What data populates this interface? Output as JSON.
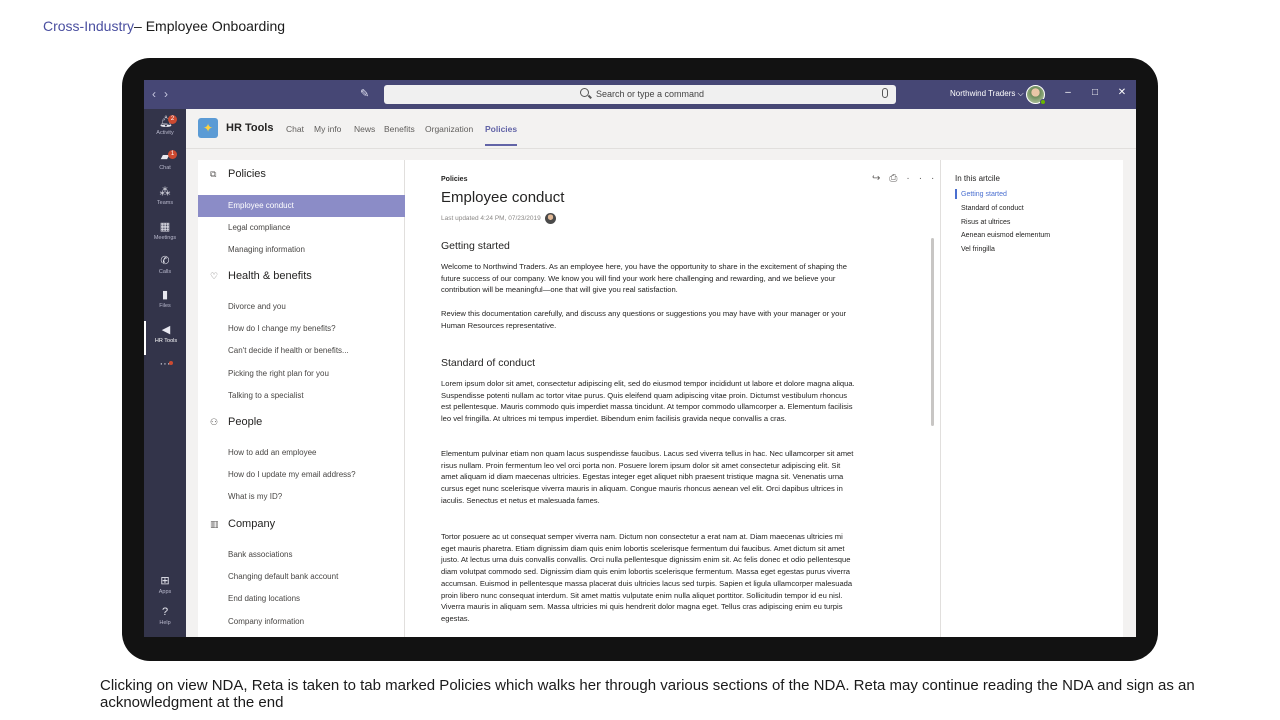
{
  "slide": {
    "category": "Cross-Industry",
    "title": "– Employee Onboarding",
    "caption": "Clicking on view NDA, Reta is taken to tab marked Policies which walks her through various sections of the NDA. Reta may continue reading the NDA and sign as an acknowledgment  at the end"
  },
  "titlebar": {
    "search_placeholder": "Search or type a command",
    "tenant": "Northwind Traders ⌵",
    "back_icon": "chevron-left-icon",
    "forward_icon": "chevron-right-icon"
  },
  "appbar": {
    "items": [
      {
        "label": "Activity",
        "icon": "bell-icon",
        "badge": "2"
      },
      {
        "label": "Chat",
        "icon": "chat-icon",
        "badge": "1"
      },
      {
        "label": "Teams",
        "icon": "teams-icon"
      },
      {
        "label": "Meetings",
        "icon": "calendar-icon"
      },
      {
        "label": "Calls",
        "icon": "phone-icon"
      },
      {
        "label": "Files",
        "icon": "files-icon"
      },
      {
        "label": "HR Tools",
        "icon": "megaphone-icon"
      },
      {
        "label": "",
        "icon": "more-icon"
      },
      {
        "label": "Apps",
        "icon": "apps-icon"
      },
      {
        "label": "Help",
        "icon": "help-icon"
      }
    ]
  },
  "tabheader": {
    "app_name": "HR Tools",
    "tabs": [
      "Chat",
      "My info",
      "News",
      "Benefits",
      "Organization",
      "Policies"
    ],
    "active_tab": "Policies"
  },
  "nav": {
    "sections": [
      {
        "label": "Policies",
        "icon": "documents-icon",
        "items": [
          "Employee conduct",
          "Legal compliance",
          "Managing information"
        ]
      },
      {
        "label": "Health & benefits",
        "icon": "heart-icon",
        "items": [
          "Divorce and you",
          "How do I change my benefits?",
          "Can't decide if health or benefits...",
          "Picking the right plan for you",
          "Talking to a specialist"
        ]
      },
      {
        "label": "People",
        "icon": "people-icon",
        "items": [
          "How to add an employee",
          "How do I update my email address?",
          "What is my ID?"
        ]
      },
      {
        "label": "Company",
        "icon": "building-icon",
        "items": [
          "Bank associations",
          "Changing default bank account",
          "End dating locations",
          "Company information"
        ]
      }
    ],
    "active_item": "Employee conduct"
  },
  "article": {
    "kicker": "Policies",
    "title": "Employee conduct",
    "meta": "Last updated 4:24 PM, 07/23/2019",
    "sections": [
      {
        "heading": "Getting started",
        "paragraphs": [
          "Welcome to Northwind Traders. As an employee here, you have the opportunity to share in the excitement of shaping the future success of our company. We know you will find your work here challenging and rewarding, and we believe your contribution will be meaningful—one that will give you real satisfaction.",
          "Review this documentation carefully, and discuss any questions or suggestions you may have with your manager or your Human Resources representative."
        ]
      },
      {
        "heading": "Standard of conduct",
        "paragraphs": [
          "Lorem ipsum dolor sit amet, consectetur adipiscing elit, sed do eiusmod tempor incididunt ut labore et dolore magna aliqua. Suspendisse potenti nullam ac tortor vitae purus. Quis eleifend quam adipiscing vitae proin. Dictumst vestibulum rhoncus est pellentesque. Mauris commodo quis imperdiet massa tincidunt. At tempor commodo ullamcorper a. Elementum facilisis leo vel fringilla. At ultrices mi tempus imperdiet. Bibendum enim facilisis gravida neque convallis a cras.",
          "Elementum pulvinar etiam non quam lacus suspendisse faucibus. Lacus sed viverra tellus in hac. Nec ullamcorper sit amet risus nullam. Proin fermentum leo vel orci porta non. Posuere lorem ipsum dolor sit amet consectetur adipiscing elit. Sit amet aliquam id diam maecenas ultricies. Egestas integer eget aliquet nibh praesent tristique magna sit. Venenatis urna cursus eget nunc scelerisque viverra mauris in aliquam. Congue mauris rhoncus aenean vel elit. Orci dapibus ultrices in iaculis. Senectus et netus et malesuada fames.",
          "Tortor posuere ac ut consequat semper viverra nam. Dictum non consectetur a erat nam at. Diam maecenas ultricies mi eget mauris pharetra. Etiam dignissim diam quis enim lobortis scelerisque fermentum dui faucibus. Amet dictum sit amet justo. At lectus urna duis convallis convallis. Orci nulla pellentesque dignissim enim sit. Ac felis donec et odio pellentesque diam volutpat commodo sed. Dignissim diam quis enim lobortis scelerisque fermentum. Massa eget egestas purus viverra accumsan. Euismod in pellentesque massa placerat duis ultricies lacus sed turpis. Sapien et ligula ullamcorper malesuada proin libero nunc consequat interdum. Sit amet mattis vulputate enim nulla aliquet porttitor. Sollicitudin tempor id eu nisl. Viverra mauris in aliquam sem. Massa ultricies mi quis hendrerit dolor magna eget. Tellus cras adipiscing enim eu turpis egestas."
        ]
      }
    ]
  },
  "toc": {
    "title": "In this artcile",
    "items": [
      "Getting started",
      "Standard of conduct",
      "Risus at ultrices",
      "Aenean euismod elementum",
      "Vel fringilla"
    ],
    "active_item": "Getting started"
  },
  "colors": {
    "titlebar": "#464775",
    "appbar": "#33344a",
    "accent": "#6264a7",
    "nav_active": "#8b8cc7"
  }
}
